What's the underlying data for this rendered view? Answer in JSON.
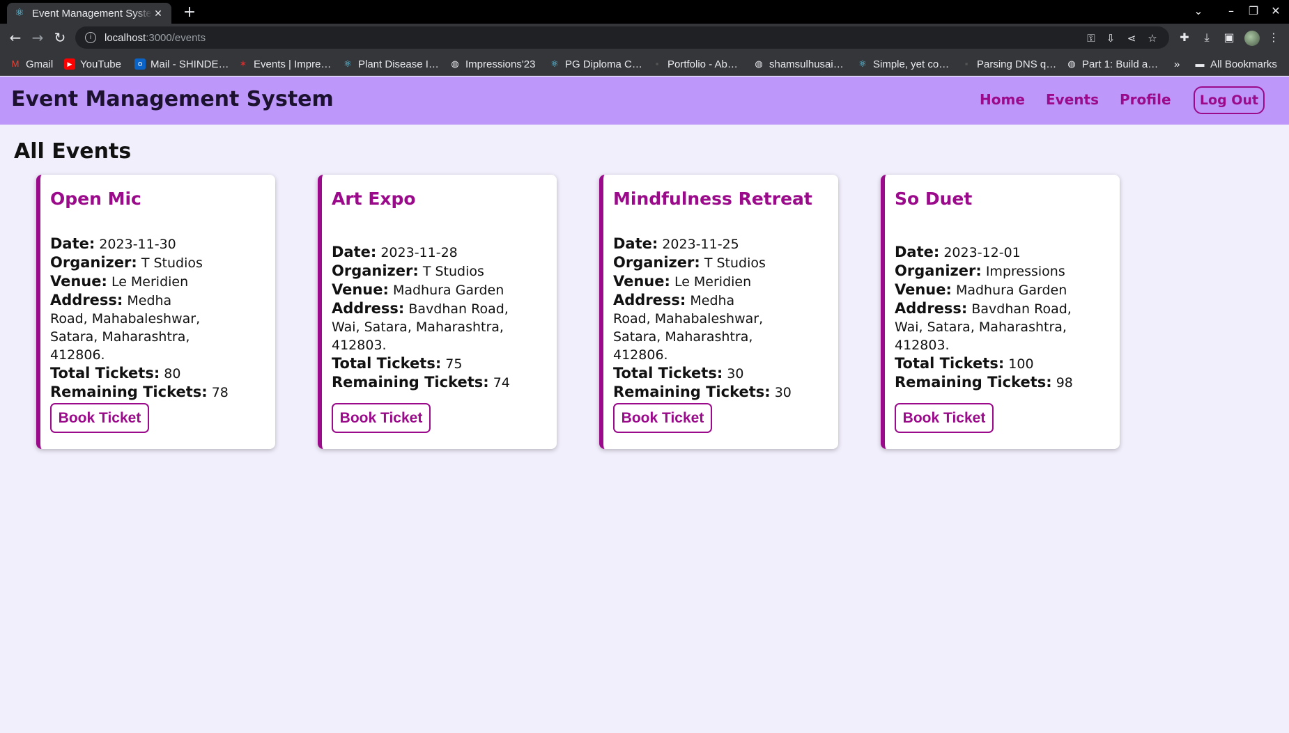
{
  "browser": {
    "tab_title": "Event Management System",
    "url_host": "localhost",
    "url_path": ":3000/events",
    "bookmarks": [
      {
        "label": "Gmail",
        "icon": "gmail-icon"
      },
      {
        "label": "YouTube",
        "icon": "youtube-icon"
      },
      {
        "label": "Mail - SHINDE…",
        "icon": "outlook-icon"
      },
      {
        "label": "Events | Impre…",
        "icon": "events-icon"
      },
      {
        "label": "Plant Disease I…",
        "icon": "react-icon"
      },
      {
        "label": "Impressions'23",
        "icon": "globe-icon"
      },
      {
        "label": "PG Diploma C…",
        "icon": "react-icon"
      },
      {
        "label": "Portfolio - Ab…",
        "icon": "portfolio-icon"
      },
      {
        "label": "shamsulhusai…",
        "icon": "globe-icon"
      },
      {
        "label": "Simple, yet co…",
        "icon": "react-icon"
      },
      {
        "label": "Parsing DNS q…",
        "icon": "dns-icon"
      },
      {
        "label": "Part 1: Build a…",
        "icon": "globe-icon"
      }
    ],
    "all_bookmarks": "All Bookmarks"
  },
  "app": {
    "title": "Event Management System",
    "nav": {
      "home": "Home",
      "events": "Events",
      "profile": "Profile",
      "logout": "Log Out"
    },
    "section_title": "All Events"
  },
  "labels": {
    "date": "Date:",
    "organizer": "Organizer:",
    "venue": "Venue:",
    "address": "Address:",
    "total": "Total Tickets:",
    "remaining": "Remaining Tickets:",
    "book": "Book Ticket"
  },
  "events": [
    {
      "title": "Open Mic",
      "date": "2023-11-30",
      "organizer": "T Studios",
      "venue": "Le Meridien",
      "address": "Medha Road, Mahabaleshwar, Satara, Maharashtra, 412806.",
      "total": "80",
      "remaining": "78"
    },
    {
      "title": "Art Expo",
      "date": "2023-11-28",
      "organizer": "T Studios",
      "venue": "Madhura Garden",
      "address": "Bavdhan Road, Wai, Satara, Maharashtra, 412803.",
      "total": "75",
      "remaining": "74"
    },
    {
      "title": "Mindfulness Retreat",
      "date": "2023-11-25",
      "organizer": "T Studios",
      "venue": "Le Meridien",
      "address": "Medha Road, Mahabaleshwar, Satara, Maharashtra, 412806.",
      "total": "30",
      "remaining": "30"
    },
    {
      "title": "So Duet",
      "date": "2023-12-01",
      "organizer": "Impressions",
      "venue": "Madhura Garden",
      "address": "Bavdhan Road, Wai, Satara, Maharashtra, 412803.",
      "total": "100",
      "remaining": "98"
    }
  ],
  "colors": {
    "header_bg": "#bd98fa",
    "accent": "#9a0a8a",
    "page_bg": "#f2effc"
  }
}
